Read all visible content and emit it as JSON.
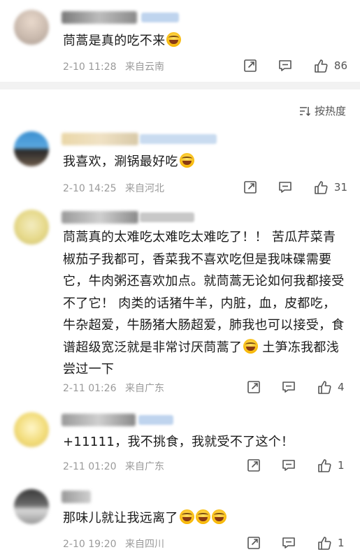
{
  "top_comment": {
    "text": "茼蒿是真的吃不来",
    "time": "2-10 11:28",
    "location": "来自云南",
    "likes": "86"
  },
  "sort": {
    "label": "按热度"
  },
  "comments": [
    {
      "text": "我喜欢，涮锅最好吃",
      "emoji": "laugh-cry-emoji",
      "time": "2-10 14:25",
      "location": "来自河北",
      "likes": "31"
    },
    {
      "text_part1": "茼蒿真的太难吃太难吃太难吃了！！ 苦瓜芹菜青椒茄子我都可，香菜我不喜欢吃但是我味碟需要它，牛肉粥还喜欢加点。就茼蒿无论如何我都接受不了它！ 肉类的话猪牛羊，内脏，血，皮都吃，牛杂超爱，牛肠猪大肠超爱，肺我也可以接受，食谱超级宽泛就是非常讨厌茼蒿了",
      "text_part2": " 土笋冻我都浅尝过一下",
      "emoji": "laugh-cry-emoji",
      "time": "2-11 01:26",
      "location": "来自广东",
      "likes": "4"
    },
    {
      "text": "+11111，我不挑食，我就受不了这个！",
      "time": "2-11 01:20",
      "location": "来自广东",
      "likes": "1"
    },
    {
      "text": "那味儿就让我远离了",
      "emoji": "laugh-cry-emoji",
      "time": "2-10 19:20",
      "location": "来自四川",
      "likes": "1"
    }
  ],
  "colors": {
    "meta_gray": "#9a9a9a",
    "divider": "#f2f2f2",
    "verified_badge": "#bfd4ee"
  }
}
